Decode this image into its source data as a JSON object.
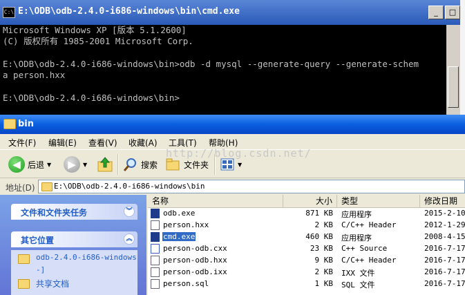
{
  "cmd": {
    "title": "E:\\ODB\\odb-2.4.0-i686-windows\\bin\\cmd.exe",
    "icon_text": "C:\\",
    "lines": [
      "Microsoft Windows XP [版本 5.1.2600]",
      "(C) 版权所有 1985-2001 Microsoft Corp.",
      "",
      "E:\\ODB\\odb-2.4.0-i686-windows\\bin>odb -d mysql --generate-query --generate-schem",
      "a person.hxx",
      "",
      "E:\\ODB\\odb-2.4.0-i686-windows\\bin>"
    ],
    "buttons": {
      "minimize": "_",
      "maximize": "□"
    }
  },
  "explorer": {
    "title": "bin",
    "menu": [
      "文件(F)",
      "编辑(E)",
      "查看(V)",
      "收藏(A)",
      "工具(T)",
      "帮助(H)"
    ],
    "toolbar": {
      "back": "后退",
      "search": "搜索",
      "folders": "文件夹"
    },
    "address": {
      "label": "地址(D)",
      "value": "E:\\ODB\\odb-2.4.0-i686-windows\\bin"
    },
    "watermark": "http://blog.csdn.net/",
    "tasks": {
      "file_tasks_title": "文件和文件夹任务",
      "other_places_title": "其它位置",
      "other_places": [
        "odb-2.4.0-i686-windows",
        "-]",
        "共享文档"
      ]
    },
    "columns": {
      "name": "名称",
      "size": "大小",
      "type": "类型",
      "modified": "修改日期"
    },
    "files": [
      {
        "name": "odb.exe",
        "size": "871 KB",
        "type": "应用程序",
        "date": "2015-2-10",
        "icon": "exe"
      },
      {
        "name": "person.hxx",
        "size": "2 KB",
        "type": "C/C++ Header",
        "date": "2012-1-29",
        "icon": "doc"
      },
      {
        "name": "cmd.exe",
        "size": "460 KB",
        "type": "应用程序",
        "date": "2008-4-15",
        "icon": "exe"
      },
      {
        "name": "person-odb.cxx",
        "size": "23 KB",
        "type": "C++ Source",
        "date": "2016-7-17",
        "icon": "cxx"
      },
      {
        "name": "person-odb.hxx",
        "size": "9 KB",
        "type": "C/C++ Header",
        "date": "2016-7-17",
        "icon": "doc"
      },
      {
        "name": "person-odb.ixx",
        "size": "2 KB",
        "type": "IXX 文件",
        "date": "2016-7-17",
        "icon": "doc"
      },
      {
        "name": "person.sql",
        "size": "1 KB",
        "type": "SQL 文件",
        "date": "2016-7-17",
        "icon": "doc"
      }
    ]
  }
}
